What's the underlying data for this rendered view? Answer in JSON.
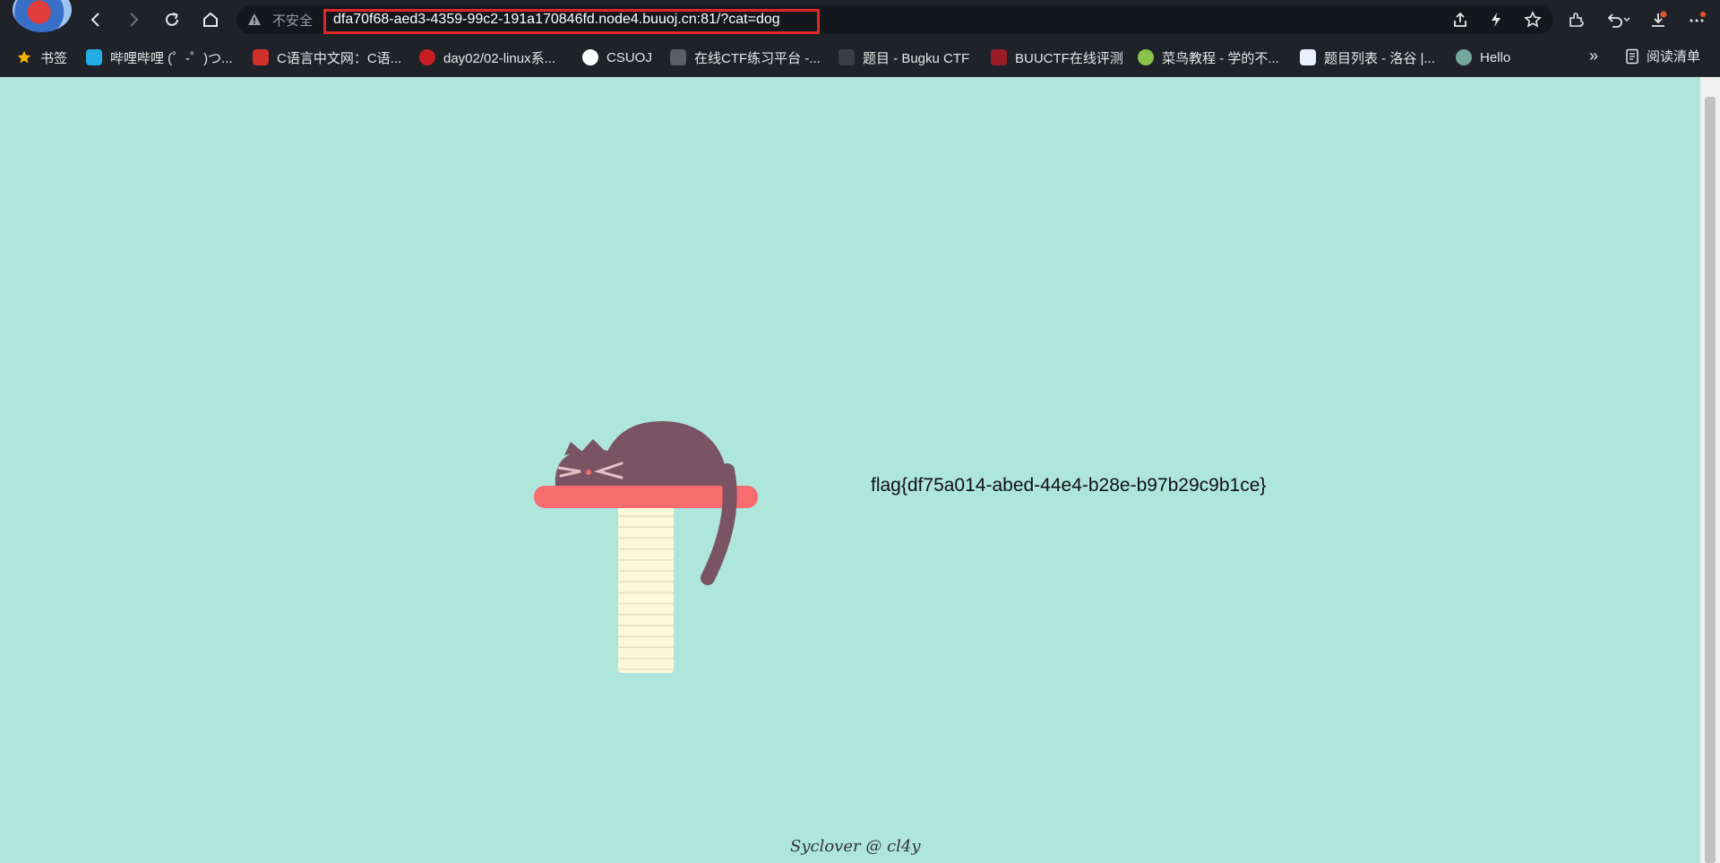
{
  "browser": {
    "security_label": "不安全",
    "url": "dfa70f68-aed3-4359-99c2-191a170846fd.node4.buuoj.cn:81/?cat=dog",
    "nav_icons": [
      "back-icon",
      "forward-icon",
      "reload-icon",
      "home-icon"
    ],
    "toolbar_icons": [
      "share-icon",
      "lightning-icon",
      "favorite-star-icon",
      "extensions-icon",
      "undo-icon",
      "download-icon",
      "more-icon"
    ]
  },
  "bookmarks": {
    "items": [
      {
        "label": "书签",
        "icon": "star-icon"
      },
      {
        "label": "哔哩哔哩 (゜-゜)つ...",
        "icon": "bilibili-icon"
      },
      {
        "label": "C语言中文网：C语...",
        "icon": "c-icon"
      },
      {
        "label": "day02/02-linux系...",
        "icon": "gitee-icon"
      },
      {
        "label": "CSUOJ",
        "icon": "csuoj-icon"
      },
      {
        "label": "在线CTF练习平台 -...",
        "icon": "ctf-icon"
      },
      {
        "label": "题目 - Bugku CTF",
        "icon": "bugku-icon"
      },
      {
        "label": "BUUCTF在线评测",
        "icon": "buuctf-icon"
      },
      {
        "label": "菜鸟教程 - 学的不...",
        "icon": "runoob-icon"
      },
      {
        "label": "题目列表 - 洛谷 |...",
        "icon": "luogu-icon"
      },
      {
        "label": "Hello",
        "icon": "openai-icon"
      }
    ],
    "overflow": "»",
    "reading_list": "阅读清单"
  },
  "page": {
    "flag_text": "flag{df75a014-abed-44e4-b28e-b97b29c9b1ce}",
    "footer": "Syclover @ cl4y"
  },
  "colors": {
    "page_bg": "#aee6dc",
    "cat": "#7a5462",
    "shelf": "#f76c6f",
    "post": "#fdf7dc",
    "url_highlight": "#e02626"
  }
}
